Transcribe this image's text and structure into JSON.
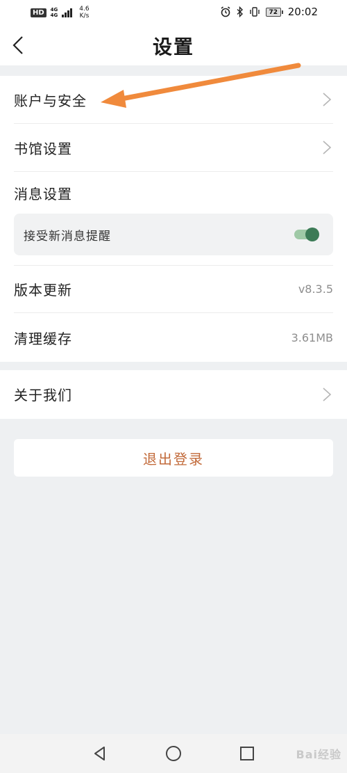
{
  "status_bar": {
    "hd": "HD",
    "net_top": "4G",
    "net_bottom": "4G",
    "speed_value": "4.6",
    "speed_unit": "K/s",
    "battery": "72",
    "time": "20:02",
    "icons": [
      "alarm-icon",
      "bluetooth-icon",
      "vibrate-icon",
      "battery-icon"
    ]
  },
  "header": {
    "title": "设置",
    "back_icon": "chevron-left-icon"
  },
  "settings": {
    "account_security": "账户与安全",
    "library_settings": "书馆设置",
    "message_settings": "消息设置",
    "receive_new_messages": "接受新消息提醒",
    "receive_new_messages_on": true,
    "version_update": "版本更新",
    "version_value": "v8.3.5",
    "clear_cache": "清理缓存",
    "cache_value": "3.61MB",
    "about_us": "关于我们"
  },
  "logout": {
    "label": "退出登录"
  },
  "annotation": {
    "arrow_color": "#f08a3c"
  },
  "nav_bar": {
    "back": "triangle-back-icon",
    "home": "circle-home-icon",
    "recents": "square-recents-icon",
    "watermark": "Bai经验"
  },
  "colors": {
    "accent_toggle": "#3c7b56",
    "logout_text": "#c26a3a",
    "background": "#eef0f2"
  }
}
